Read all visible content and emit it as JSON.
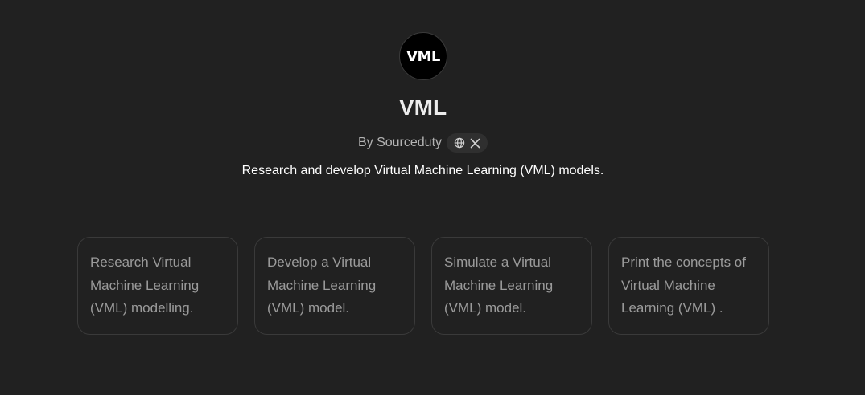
{
  "gpt": {
    "avatar_text": "VML",
    "title": "VML",
    "author": "By Sourceduty",
    "description": "Research and develop Virtual Machine Learning (VML) models."
  },
  "social_icons": [
    "globe-icon",
    "x-icon"
  ],
  "starters": [
    {
      "text": "Research Virtual Machine Learning (VML) modelling."
    },
    {
      "text": "Develop a Virtual Machine Learning (VML) model."
    },
    {
      "text": "Simulate a Virtual Machine Learning (VML) model."
    },
    {
      "text": "Print the concepts of Virtual Machine Learning (VML) ."
    }
  ],
  "colors": {
    "background": "#212121",
    "title": "#ececec",
    "author": "#b4b4b4",
    "starter_text": "#9b9b9b",
    "card_border": "#3a3a3a"
  }
}
